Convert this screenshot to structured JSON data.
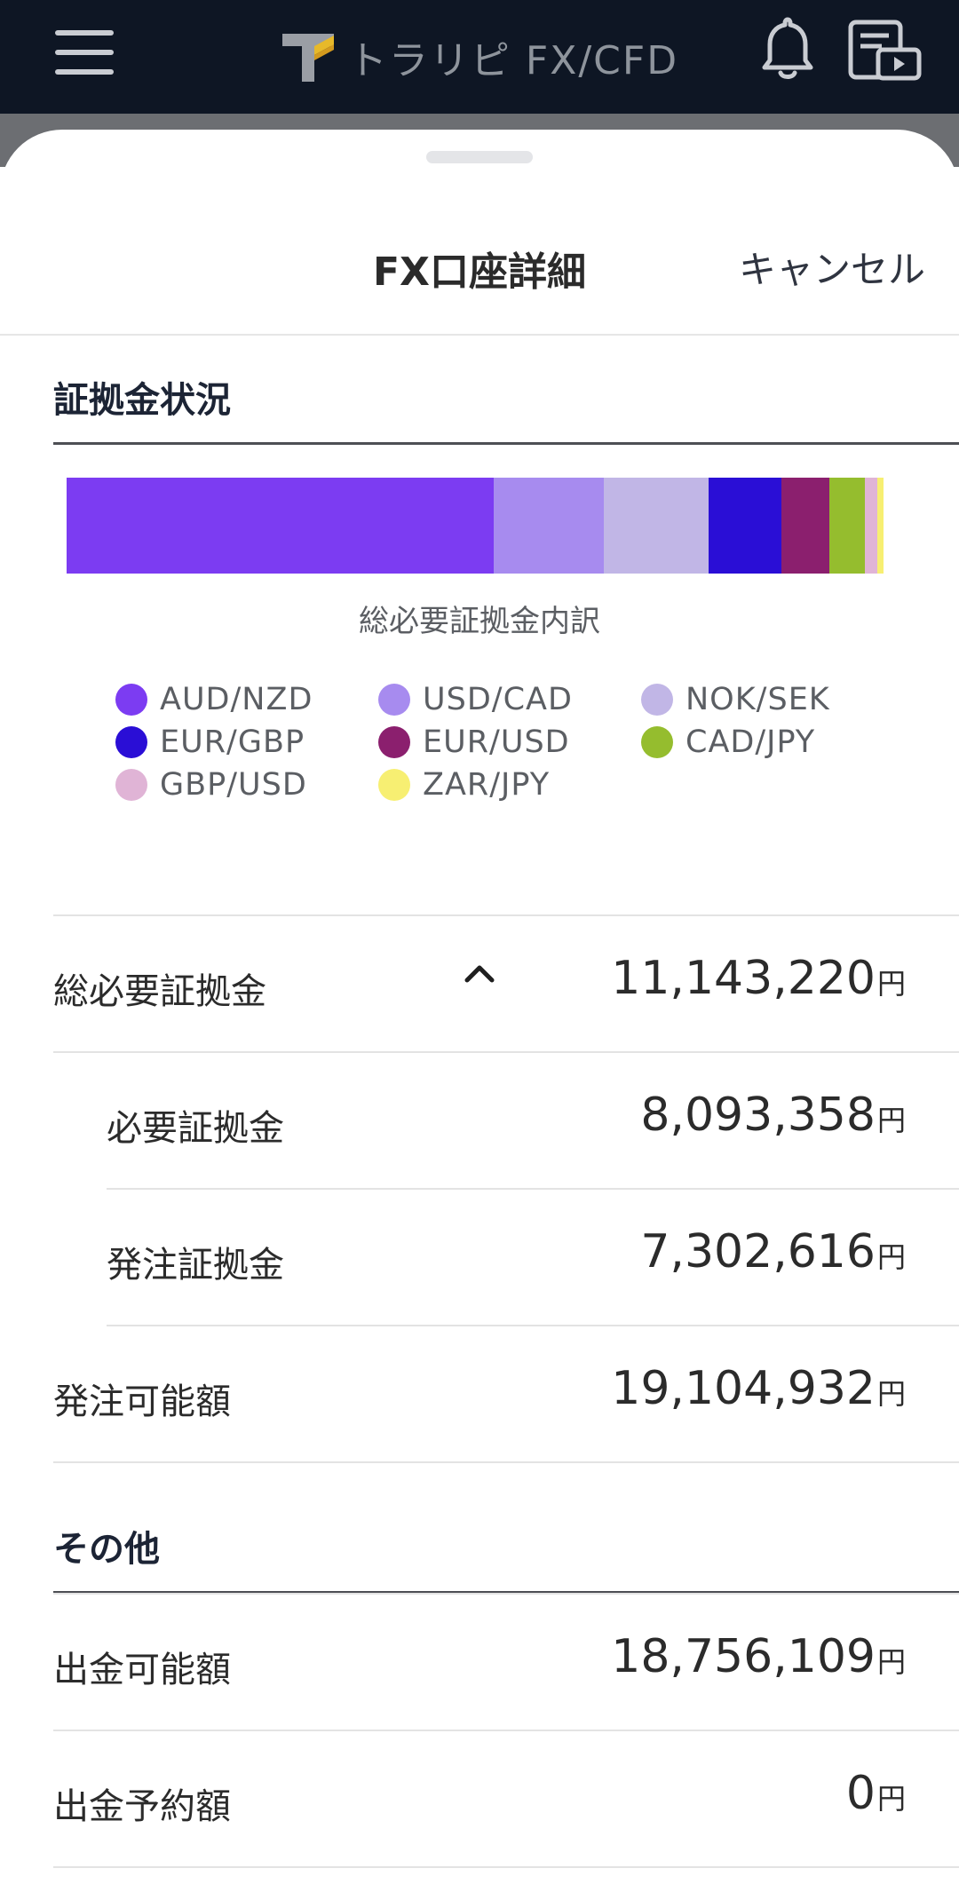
{
  "appbar": {
    "brand": "トラリピ FX/CFD",
    "menu_icon": "hamburger-menu-icon",
    "bell_icon": "bell-icon",
    "doc_icon": "document-play-icon"
  },
  "sheet": {
    "title": "FX口座詳細",
    "cancel_label": "キャンセル"
  },
  "margin_section": {
    "title": "証拠金状況",
    "caption": "総必要証拠金内訳",
    "breakdown": [
      {
        "pair": "AUD/NZD",
        "color": "#7c3cf2",
        "share": 0.523
      },
      {
        "pair": "USD/CAD",
        "color": "#a78bef",
        "share": 0.135
      },
      {
        "pair": "NOK/SEK",
        "color": "#c1b6e6",
        "share": 0.128
      },
      {
        "pair": "EUR/GBP",
        "color": "#2a0ed6",
        "share": 0.089
      },
      {
        "pair": "EUR/USD",
        "color": "#8b1f6e",
        "share": 0.059
      },
      {
        "pair": "CAD/JPY",
        "color": "#95bd2e",
        "share": 0.043
      },
      {
        "pair": "GBP/USD",
        "color": "#e0b4d6",
        "share": 0.015
      },
      {
        "pair": "ZAR/JPY",
        "color": "#f7ef72",
        "share": 0.008
      }
    ],
    "collapse_icon": "chevron-up-icon"
  },
  "rows": [
    {
      "label": "総必要証拠金",
      "value": "11,143,220",
      "unit": "円"
    },
    {
      "label": "必要証拠金",
      "value": "8,093,358",
      "unit": "円"
    },
    {
      "label": "発注証拠金",
      "value": "7,302,616",
      "unit": "円"
    },
    {
      "label": "発注可能額",
      "value": "19,104,932",
      "unit": "円"
    }
  ],
  "other_section": {
    "title": "その他",
    "rows": [
      {
        "label": "出金可能額",
        "value": "18,756,109",
        "unit": "円"
      },
      {
        "label": "出金予約額",
        "value": "0",
        "unit": "円"
      }
    ]
  }
}
